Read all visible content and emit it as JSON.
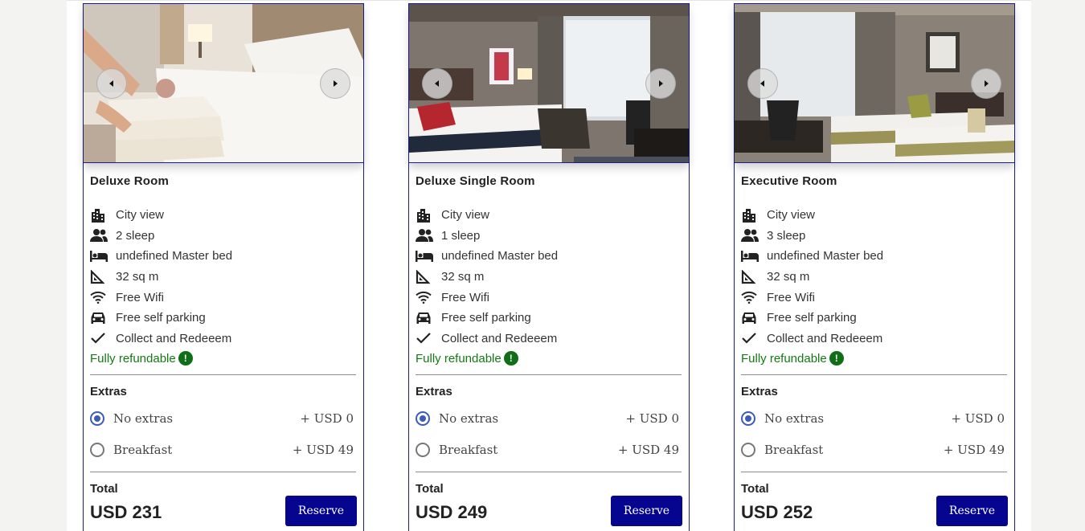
{
  "rooms": [
    {
      "title": "Deluxe Room",
      "features": [
        "City view",
        "2 sleep",
        "undefined Master bed",
        "32 sq m",
        "Free Wifi",
        "Free self parking",
        "Collect and Redeeem"
      ],
      "refundable": "Fully refundable",
      "extras_title": "Extras",
      "extras": [
        {
          "label": "No extras",
          "price": "+ USD 0",
          "selected": true
        },
        {
          "label": "Breakfast",
          "price": "+ USD 49",
          "selected": false
        }
      ],
      "total_label": "Total",
      "total": "USD 231",
      "reserve_label": "Reserve"
    },
    {
      "title": "Deluxe Single Room",
      "features": [
        "City view",
        "1 sleep",
        "undefined Master bed",
        "32 sq m",
        "Free Wifi",
        "Free self parking",
        "Collect and Redeeem"
      ],
      "refundable": "Fully refundable",
      "extras_title": "Extras",
      "extras": [
        {
          "label": "No extras",
          "price": "+ USD 0",
          "selected": true
        },
        {
          "label": "Breakfast",
          "price": "+ USD 49",
          "selected": false
        }
      ],
      "total_label": "Total",
      "total": "USD 249",
      "reserve_label": "Reserve"
    },
    {
      "title": "Executive Room",
      "features": [
        "City view",
        "3 sleep",
        "undefined Master bed",
        "32 sq m",
        "Free Wifi",
        "Free self parking",
        "Collect and Redeeem"
      ],
      "refundable": "Fully refundable",
      "extras_title": "Extras",
      "extras": [
        {
          "label": "No extras",
          "price": "+ USD 0",
          "selected": true
        },
        {
          "label": "Breakfast",
          "price": "+ USD 49",
          "selected": false
        }
      ],
      "total_label": "Total",
      "total": "USD 252",
      "reserve_label": "Reserve"
    }
  ],
  "feature_icons": [
    "city-icon",
    "people-icon",
    "bed-icon",
    "area-icon",
    "wifi-icon",
    "car-icon",
    "check-icon"
  ],
  "colors": {
    "brand": "#05058f",
    "refund": "#137a13",
    "radio": "#3d5bb8"
  }
}
